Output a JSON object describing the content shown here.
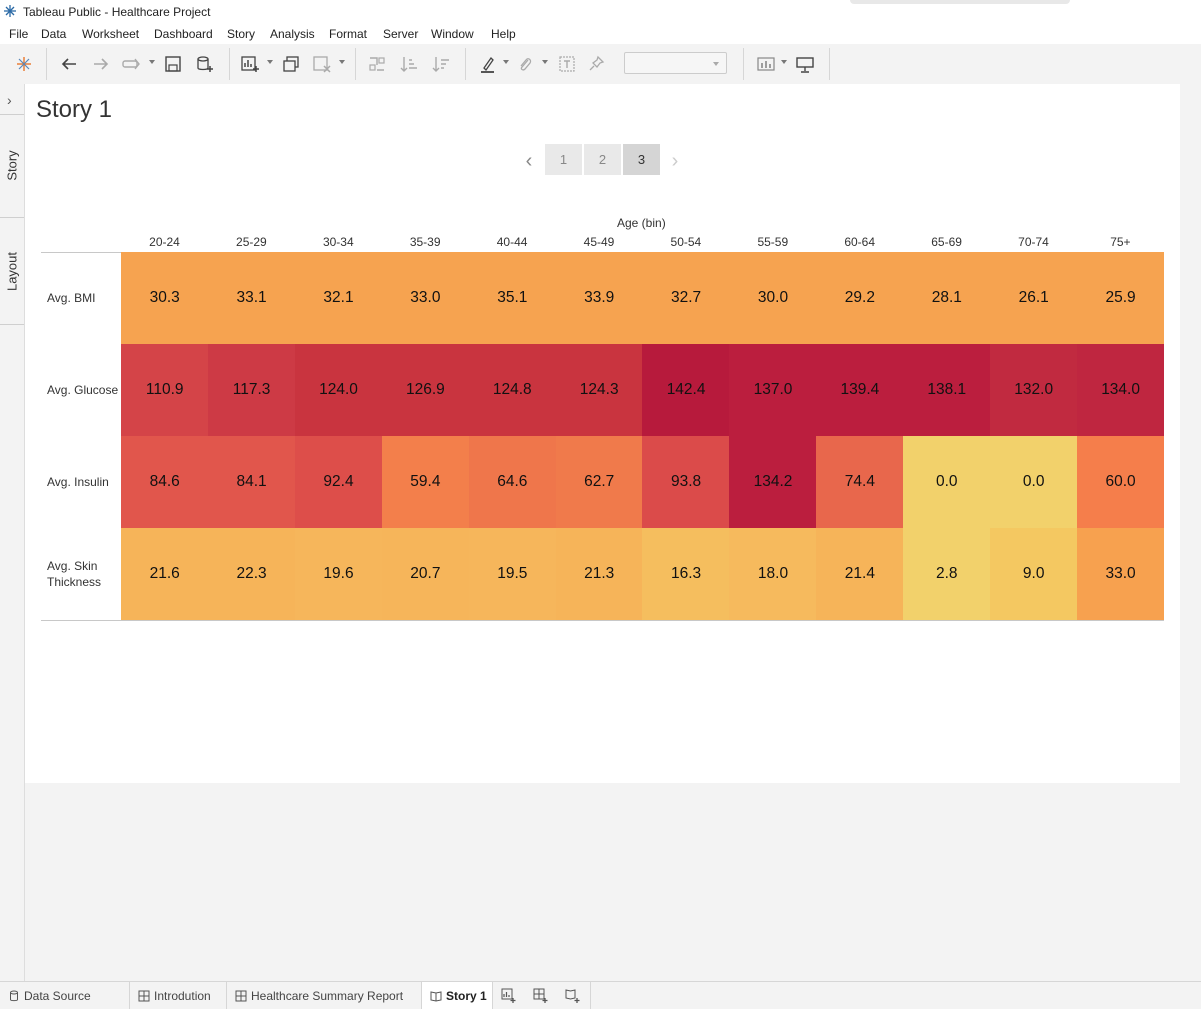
{
  "window": {
    "title": "Tableau Public - Healthcare Project"
  },
  "menu": [
    "File",
    "Data",
    "Worksheet",
    "Dashboard",
    "Story",
    "Analysis",
    "Format",
    "Server",
    "Window",
    "Help"
  ],
  "toolbar": {
    "icons": [
      "tableau-logo-icon",
      "undo-icon",
      "redo-icon",
      "replay-icon",
      "save-icon",
      "new-data-source-icon",
      "new-worksheet-icon",
      "duplicate-icon",
      "clear-sheet-icon",
      "swap-icon",
      "sort-ascending-icon",
      "sort-descending-icon",
      "highlight-icon",
      "attach-icon",
      "label-icon",
      "pin-icon",
      "show-me-icon",
      "presentation-icon"
    ],
    "fit_select": ""
  },
  "left_rail": {
    "story_tab": "Story",
    "layout_tab": "Layout"
  },
  "story": {
    "title": "Story 1",
    "points": [
      "1",
      "2",
      "3"
    ],
    "active_point": "3"
  },
  "heatmap": {
    "x_title": "Age (bin)",
    "columns": [
      "20-24",
      "25-29",
      "30-34",
      "35-39",
      "40-44",
      "45-49",
      "50-54",
      "55-59",
      "60-64",
      "65-69",
      "70-74",
      "75+"
    ],
    "rows": [
      {
        "label": "Avg. BMI",
        "values": [
          "30.3",
          "33.1",
          "32.1",
          "33.0",
          "35.1",
          "33.9",
          "32.7",
          "30.0",
          "29.2",
          "28.1",
          "26.1",
          "25.9"
        ],
        "colors": [
          "#f6a350",
          "#f6a350",
          "#f6a350",
          "#f6a350",
          "#f6a350",
          "#f6a350",
          "#f6a350",
          "#f6a350",
          "#f6a350",
          "#f6a350",
          "#f6a350",
          "#f6a350"
        ]
      },
      {
        "label": "Avg. Glucose",
        "values": [
          "110.9",
          "117.3",
          "124.0",
          "126.9",
          "124.8",
          "124.3",
          "142.4",
          "137.0",
          "139.4",
          "138.1",
          "132.0",
          "134.0"
        ],
        "colors": [
          "#d44448",
          "#cd3a45",
          "#c9343f",
          "#c9343f",
          "#c9343f",
          "#c9343f",
          "#b71a3c",
          "#bb1e3e",
          "#bb1e3e",
          "#bb1e3e",
          "#c12a40",
          "#bf2640"
        ]
      },
      {
        "label": "Avg. Insulin",
        "values": [
          "84.6",
          "84.1",
          "92.4",
          "59.4",
          "64.6",
          "62.7",
          "93.8",
          "134.2",
          "74.4",
          "0.0",
          "0.0",
          "60.0"
        ],
        "colors": [
          "#e1564c",
          "#e1564c",
          "#dd4e4a",
          "#f37f4b",
          "#ef764b",
          "#f07a4b",
          "#db4b4a",
          "#bb1e3e",
          "#e8674c",
          "#f2d16b",
          "#f2d16b",
          "#f57e4b"
        ]
      },
      {
        "label": "Avg. Skin Thickness",
        "values": [
          "21.6",
          "22.3",
          "19.6",
          "20.7",
          "19.5",
          "21.3",
          "16.3",
          "18.0",
          "21.4",
          "2.8",
          "9.0",
          "33.0"
        ],
        "colors": [
          "#f6b459",
          "#f6b459",
          "#f6b65b",
          "#f6b55a",
          "#f6b65b",
          "#f6b459",
          "#f5be5e",
          "#f6ba5d",
          "#f6b459",
          "#f2d16b",
          "#f4c861",
          "#f7a14f"
        ]
      }
    ]
  },
  "tabs": [
    {
      "label": "Data Source",
      "icon": "data-source-icon"
    },
    {
      "label": "Introdution",
      "icon": "sheet-icon"
    },
    {
      "label": "Healthcare Summary Report",
      "icon": "sheet-icon"
    },
    {
      "label": "Story 1",
      "icon": "story-icon",
      "active": true
    }
  ]
}
